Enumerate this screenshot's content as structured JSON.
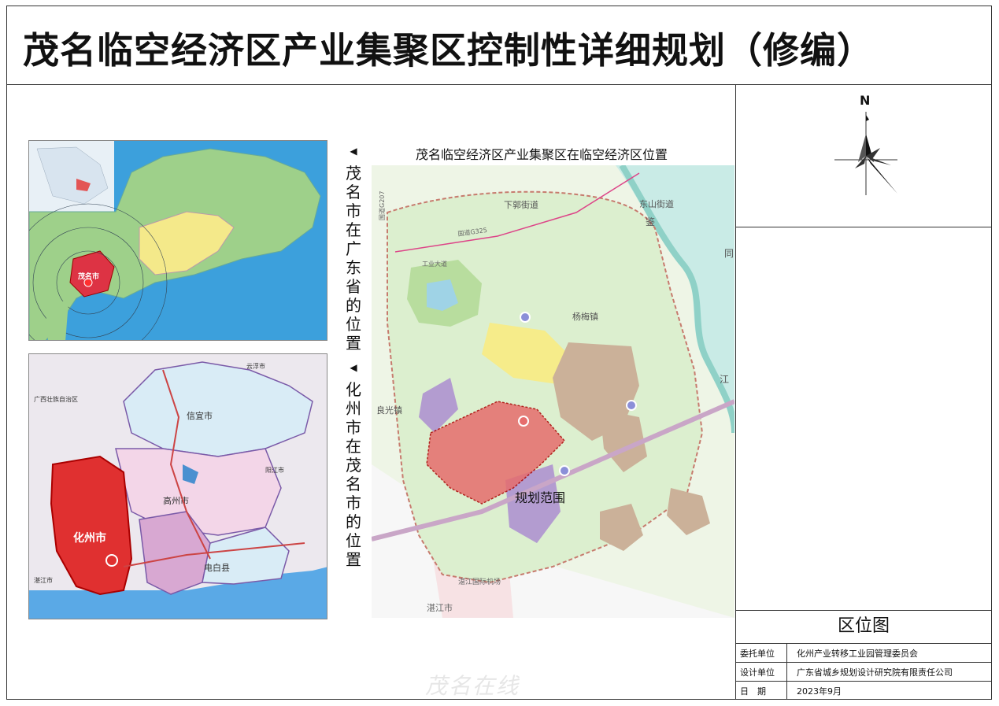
{
  "header": {
    "title": "茂名临空经济区产业集聚区控制性详细规划（修编）"
  },
  "north_label": "N",
  "panels": {
    "province_label": "茂名市在广东省的位置",
    "province_city": "茂名市",
    "city_label": "化州市在茂名市的位置",
    "city_places": {
      "huazhou": "化州市",
      "gaozhou": "高州市",
      "xinyi": "信宜市",
      "dianbai": "电白县",
      "yunfu": "云浮市",
      "yangjiang": "阳江市",
      "zhanjiang": "湛江市",
      "guangxi": "广西壮族自治区"
    }
  },
  "main_map": {
    "caption": "茂名临空经济区产业集聚区在临空经济区位置",
    "plan_area_label": "规划范围",
    "labels": {
      "xiaguo": "下郭街道",
      "dongshan": "东山街道",
      "yangmei": "杨梅镇",
      "liangguang": "良光镇",
      "airport": "湛江国际机场",
      "zhanjiang": "湛江市",
      "g207": "国道G207",
      "g325": "国道G325",
      "gongye": "工业大道",
      "jian": "鉴",
      "tong": "同",
      "jiang": "江"
    }
  },
  "info": {
    "legend_title": "区位图",
    "rows": [
      {
        "key": "委托单位",
        "value": "化州产业转移工业园管理委员会"
      },
      {
        "key": "设计单位",
        "value": "广东省城乡规划设计研究院有限责任公司"
      },
      {
        "key": "日　期",
        "value": "2023年9月"
      }
    ]
  },
  "watermark": "茂名在线"
}
